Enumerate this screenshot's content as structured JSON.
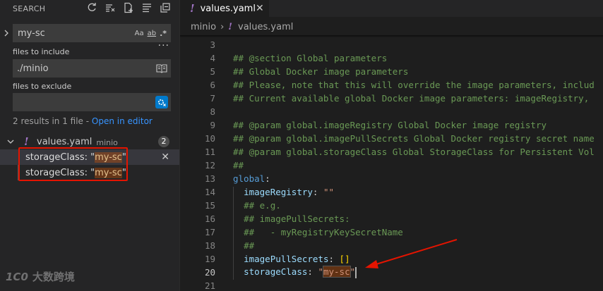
{
  "sidebar": {
    "title": "SEARCH",
    "actions": [
      "refresh-icon",
      "clear-results-icon",
      "new-search-editor-icon",
      "view-as-tree-icon",
      "collapse-all-icon"
    ],
    "search": {
      "value": "my-sc",
      "options": [
        "Aa",
        "ab",
        ".*"
      ]
    },
    "more": "···",
    "include_label": "files to include",
    "include_value": "./minio",
    "exclude_label": "files to exclude",
    "exclude_value": "",
    "summary": {
      "text": "2 results in 1 file - ",
      "link": "Open in editor"
    },
    "file": {
      "icon": "!",
      "name": "values.yaml",
      "folder": "minio",
      "count": "2"
    },
    "matches": [
      {
        "before": "storageClass: \"",
        "match": "my-sc",
        "after": "\""
      },
      {
        "before": "storageClass: \"",
        "match": "my-sc",
        "after": "\""
      }
    ],
    "watermark": {
      "logo": "1C0",
      "text": "大数跨境"
    }
  },
  "editor": {
    "tab": {
      "icon": "!",
      "label": "values.yaml",
      "close": "✕"
    },
    "breadcrumb": {
      "folder": "minio",
      "sep": "›",
      "icon": "!",
      "file": "values.yaml"
    },
    "lines": [
      {
        "n": "3",
        "text": ""
      },
      {
        "n": "4",
        "text": "## @section Global parameters"
      },
      {
        "n": "5",
        "text": "## Global Docker image parameters"
      },
      {
        "n": "6",
        "text": "## Please, note that this will override the image parameters, includ"
      },
      {
        "n": "7",
        "text": "## Current available global Docker image parameters: imageRegistry, "
      },
      {
        "n": "8",
        "text": ""
      },
      {
        "n": "9",
        "text": "## @param global.imageRegistry Global Docker image registry"
      },
      {
        "n": "10",
        "text": "## @param global.imagePullSecrets Global Docker registry secret name"
      },
      {
        "n": "11",
        "text": "## @param global.storageClass Global StorageClass for Persistent Vol"
      },
      {
        "n": "12",
        "text": "##"
      },
      {
        "n": "13",
        "key": "global",
        "punc": ":"
      },
      {
        "n": "14",
        "key2": "imageRegistry",
        "punc": ": ",
        "str": "\"\""
      },
      {
        "n": "15",
        "text": "## e.g."
      },
      {
        "n": "16",
        "text": "## imagePullSecrets:"
      },
      {
        "n": "17",
        "text": "##   - myRegistryKeySecretName"
      },
      {
        "n": "18",
        "text": "##"
      },
      {
        "n": "19",
        "key2": "imagePullSecrets",
        "punc": ": ",
        "bracket": "[]"
      },
      {
        "n": "20",
        "key2": "storageClass",
        "punc": ": ",
        "str_open": "\"",
        "match": "my-sc",
        "str_close": "\""
      },
      {
        "n": "21",
        "text": ""
      }
    ]
  },
  "colors": {
    "accent": "#007acc",
    "highlight_box": "#e51400",
    "yaml_icon": "#a074c4"
  }
}
